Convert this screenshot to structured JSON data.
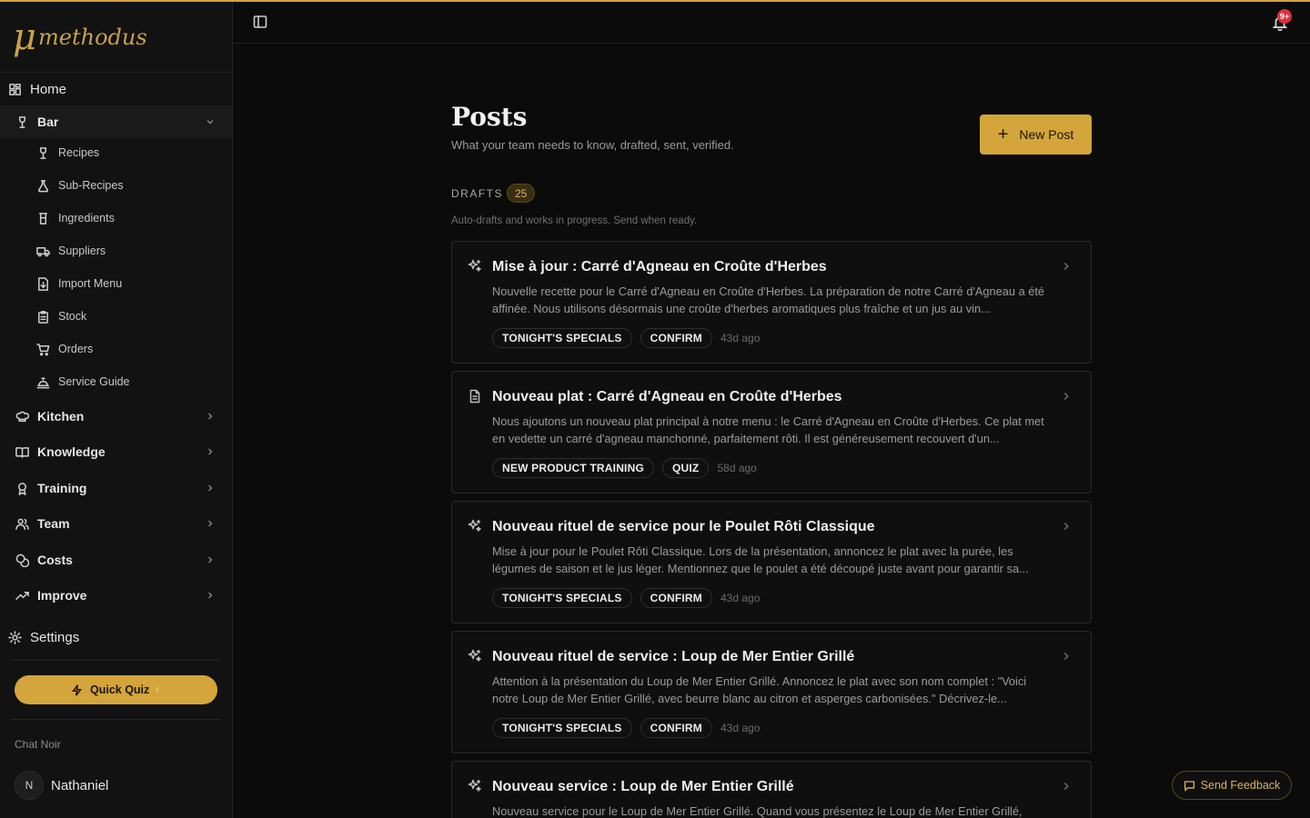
{
  "brand": {
    "mark": "μ",
    "name": "methodus",
    "accent": "#d4a53a"
  },
  "sidebar": {
    "home": "Home",
    "groups": [
      {
        "label": "Bar",
        "expanded": true,
        "icon": "wine-glass-icon"
      },
      {
        "label": "Kitchen",
        "icon": "chef-hat-icon"
      },
      {
        "label": "Knowledge",
        "icon": "book-icon"
      },
      {
        "label": "Training",
        "icon": "award-icon"
      },
      {
        "label": "Team",
        "icon": "users-icon"
      },
      {
        "label": "Costs",
        "icon": "coins-icon"
      },
      {
        "label": "Improve",
        "icon": "trending-up-icon"
      }
    ],
    "bar_items": [
      {
        "label": "Recipes",
        "icon": "wine-glass-icon"
      },
      {
        "label": "Sub-Recipes",
        "icon": "flask-icon"
      },
      {
        "label": "Ingredients",
        "icon": "bottle-icon"
      },
      {
        "label": "Suppliers",
        "icon": "truck-icon"
      },
      {
        "label": "Import Menu",
        "icon": "file-import-icon"
      },
      {
        "label": "Stock",
        "icon": "clipboard-icon"
      },
      {
        "label": "Orders",
        "icon": "cart-icon"
      },
      {
        "label": "Service Guide",
        "icon": "cloche-icon"
      }
    ],
    "settings": "Settings",
    "quiz_button": "Quick Quiz",
    "quiz_sparkle": "⚡",
    "workspace": "Chat Noir",
    "user": {
      "initial": "N",
      "name": "Nathaniel"
    }
  },
  "header": {
    "notifications_badge": "9+"
  },
  "main": {
    "title": "Posts",
    "subtitle": "What your team needs to know, drafted, sent, verified.",
    "new_post": "New Post",
    "drafts_label": "DRAFTS",
    "drafts_count": "25",
    "drafts_hint": "Auto-drafts and works in progress. Send when ready.",
    "posts": [
      {
        "icon": "sparkles-icon",
        "title": "Mise à jour : Carré d'Agneau en Croûte d'Herbes",
        "body": "Nouvelle recette pour le Carré d'Agneau en Croûte d'Herbes. La préparation de notre Carré d'Agneau a été affinée. Nous utilisons désormais une croûte d'herbes aromatiques plus fraîche et un jus au vin...",
        "tags": [
          "TONIGHT'S SPECIALS",
          "CONFIRM"
        ],
        "age": "43d ago"
      },
      {
        "icon": "document-icon",
        "title": "Nouveau plat : Carré d'Agneau en Croûte d'Herbes",
        "body": "Nous ajoutons un nouveau plat principal à notre menu : le Carré d'Agneau en Croûte d'Herbes. Ce plat met en vedette un carré d'agneau manchonné, parfaitement rôti. Il est généreusement recouvert d'un...",
        "tags": [
          "NEW PRODUCT TRAINING",
          "QUIZ"
        ],
        "age": "58d ago"
      },
      {
        "icon": "sparkles-icon",
        "title": "Nouveau rituel de service pour le Poulet Rôti Classique",
        "body": "Mise à jour pour le Poulet Rôti Classique. Lors de la présentation, annoncez le plat avec la purée, les légumes de saison et le jus léger. Mentionnez que le poulet a été découpé juste avant pour garantir sa...",
        "tags": [
          "TONIGHT'S SPECIALS",
          "CONFIRM"
        ],
        "age": "43d ago"
      },
      {
        "icon": "sparkles-icon",
        "title": "Nouveau rituel de service : Loup de Mer Entier Grillé",
        "body": "Attention à la présentation du Loup de Mer Entier Grillé. Annoncez le plat avec son nom complet : \"Voici notre Loup de Mer Entier Grillé, avec beurre blanc au citron et asperges carbonisées.\" Décrivez-le...",
        "tags": [
          "TONIGHT'S SPECIALS",
          "CONFIRM"
        ],
        "age": "43d ago"
      },
      {
        "icon": "sparkles-icon",
        "title": "Nouveau service : Loup de Mer Entier Grillé",
        "body": "Nouveau service pour le Loup de Mer Entier Grillé. Quand vous présentez le Loup de Mer Entier Grillé,",
        "tags": [],
        "age": ""
      }
    ]
  },
  "feedback_button": "Send Feedback"
}
